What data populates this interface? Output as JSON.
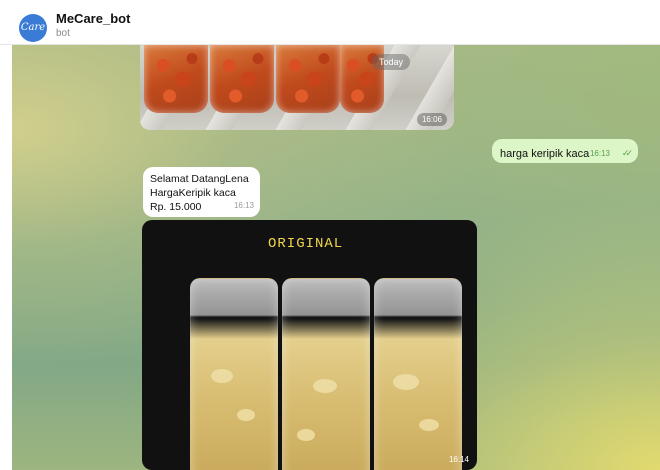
{
  "header": {
    "avatar_text": "Care",
    "avatar_mark": "♠",
    "title": "MeCare_bot",
    "subtitle": "bot"
  },
  "messages": {
    "photo1": {
      "date_badge": "Today",
      "time": "16:06"
    },
    "outgoing": {
      "text": "harga keripik kaca",
      "time": "16:13"
    },
    "incoming": {
      "line1": "Selamat DatangLena",
      "line2": "HargaKeripik kaca",
      "line3": "Rp. 15.000",
      "time": "16:13"
    },
    "photo2": {
      "caption_in_image": "ORIGINAL",
      "time": "16:14"
    }
  },
  "colors": {
    "outgoing_bubble": "#ddf6c8",
    "incoming_bubble": "#ffffff",
    "read_ticks": "#5aa04b",
    "caption_yellow": "#f1d64a"
  }
}
